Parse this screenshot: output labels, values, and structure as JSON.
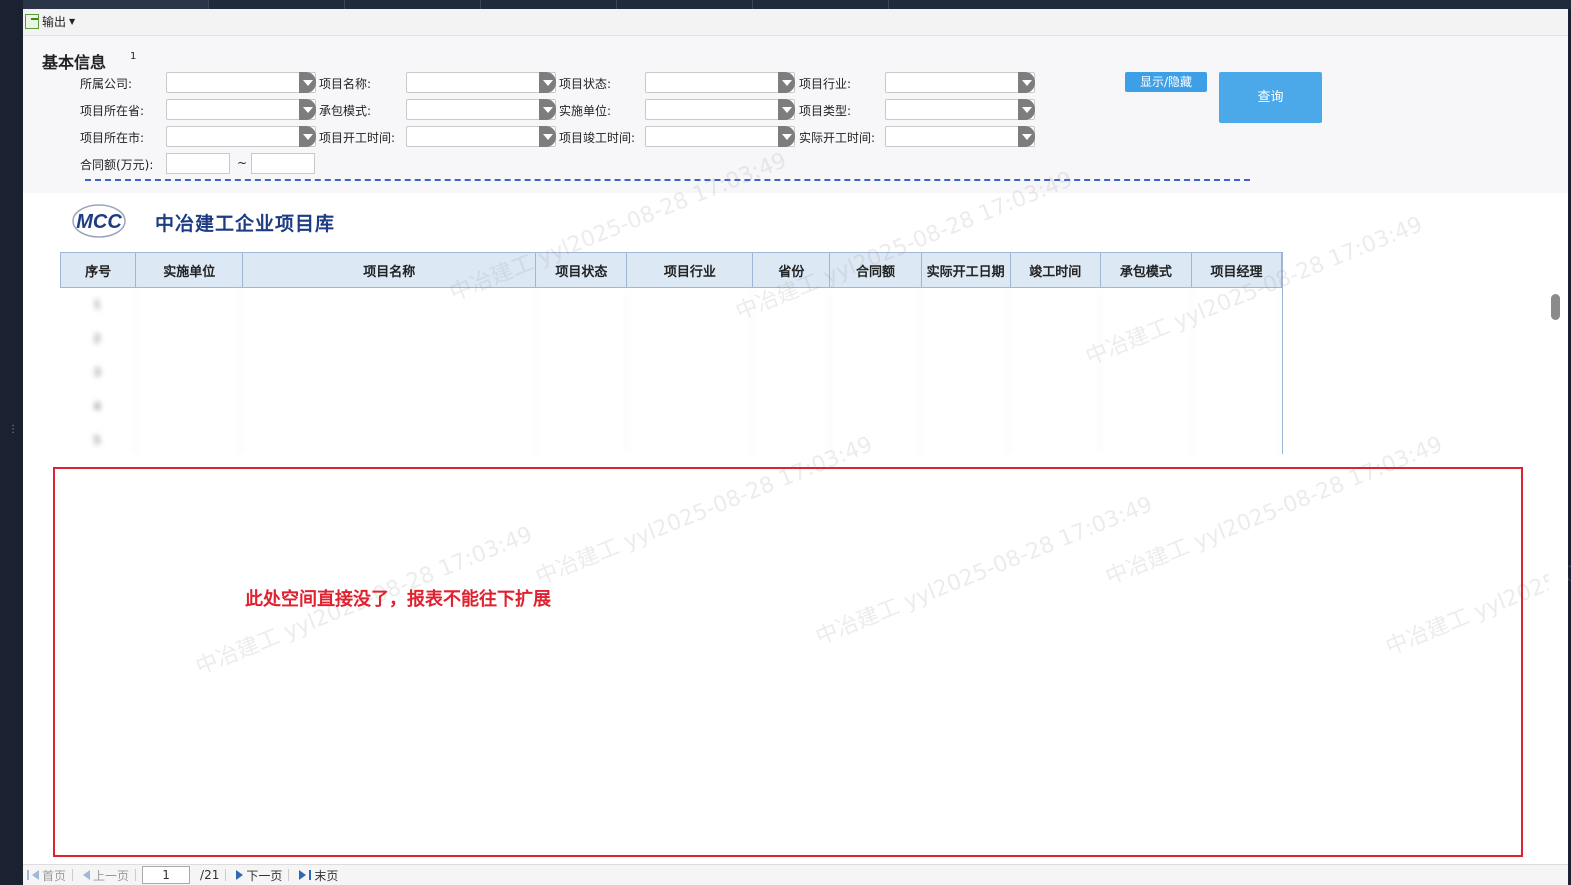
{
  "toolbar": {
    "export_label": "输出"
  },
  "query_panel": {
    "section_title": "基本信息",
    "section_mark": "1",
    "fields": [
      {
        "name": "company",
        "label": "所属公司:"
      },
      {
        "name": "project-name",
        "label": "项目名称:"
      },
      {
        "name": "project-status",
        "label": "项目状态:"
      },
      {
        "name": "industry",
        "label": "项目行业:"
      },
      {
        "name": "province",
        "label": "项目所在省:"
      },
      {
        "name": "contract-mode",
        "label": "承包模式:"
      },
      {
        "name": "implementing-unit",
        "label": "实施单位:"
      },
      {
        "name": "project-type",
        "label": "项目类型:"
      },
      {
        "name": "city",
        "label": "项目所在市:"
      },
      {
        "name": "start-time",
        "label": "项目开工时间:"
      },
      {
        "name": "completion-time",
        "label": "项目竣工时间:"
      },
      {
        "name": "actual-start-time",
        "label": "实际开工时间:"
      }
    ],
    "contract_amount_label": "合同额(万元):",
    "range_sep": "~",
    "toggle_button": "显示/隐藏",
    "query_button": "查询"
  },
  "report": {
    "logo_text": "MCC",
    "title": "中冶建工企业项目库",
    "columns": [
      "序号",
      "实施单位",
      "项目名称",
      "项目状态",
      "项目行业",
      "省份",
      "合同额",
      "实际开工日期",
      "竣工时间",
      "承包模式",
      "项目经理"
    ],
    "rows": [
      [
        "1",
        "",
        "",
        "",
        "",
        "",
        "",
        "",
        "",
        "",
        ""
      ],
      [
        "2",
        "",
        "",
        "",
        "",
        "",
        "",
        "",
        "",
        "",
        ""
      ],
      [
        "3",
        "",
        "",
        "",
        "",
        "",
        "",
        "",
        "",
        "",
        ""
      ],
      [
        "4",
        "",
        "",
        "",
        "",
        "",
        "",
        "",
        "",
        "",
        ""
      ],
      [
        "5",
        "",
        "",
        "",
        "",
        "",
        "",
        "",
        "",
        "",
        ""
      ]
    ],
    "note": "此处空间直接没了，报表不能往下扩展",
    "watermark": "中冶建工 yyl2025-08-28 17:03:49"
  },
  "pager": {
    "first": "首页",
    "prev": "上一页",
    "current_page": "1",
    "total": "/21",
    "next": "下一页",
    "last": "末页"
  },
  "colors": {
    "accent": "#3d9fe6",
    "note_red": "#e0212f",
    "title_blue": "#1d3c82"
  }
}
